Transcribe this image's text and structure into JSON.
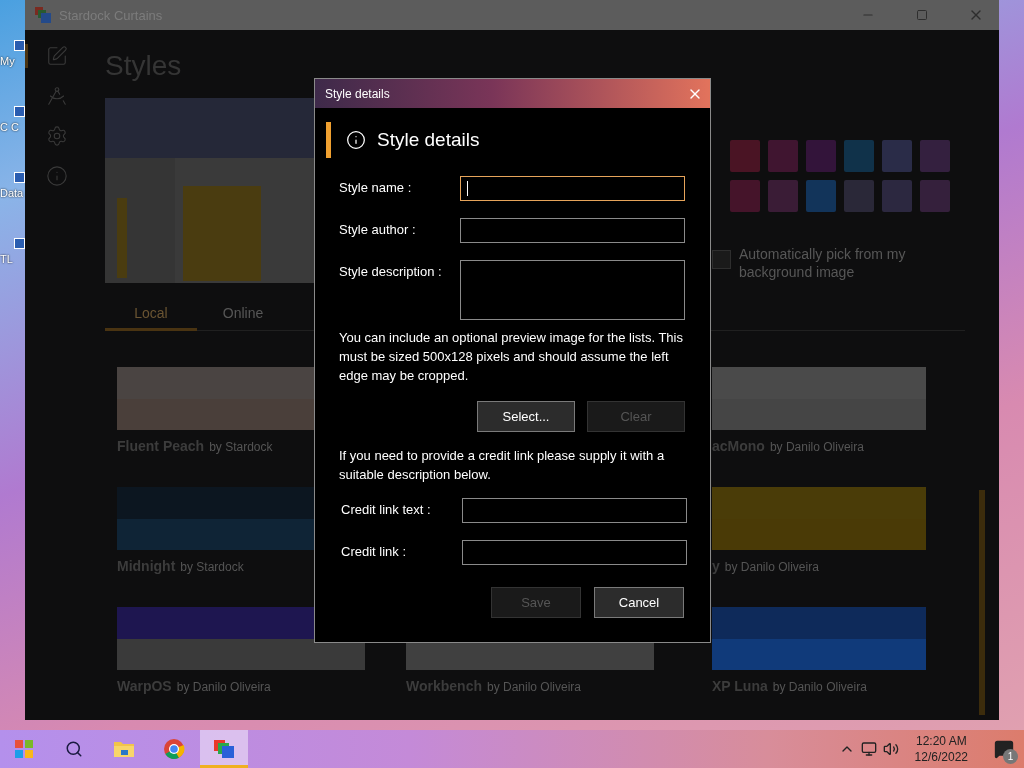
{
  "desktop_icons": [
    {
      "label": "My"
    },
    {
      "label": "C C"
    },
    {
      "label": "Data"
    },
    {
      "label": "TL"
    }
  ],
  "app": {
    "title": "Stardock Curtains",
    "sidebar": [
      {
        "kind": "edit",
        "selected": true
      },
      {
        "kind": "drafting",
        "selected": false
      },
      {
        "kind": "settings",
        "selected": false
      },
      {
        "kind": "info",
        "selected": false
      }
    ],
    "heading": "Styles",
    "swatches": [
      {
        "color": "#4a1424"
      },
      {
        "color": "#401530"
      },
      {
        "color": "#33143a"
      },
      {
        "color": "#10324a"
      },
      {
        "color": "#2a2c48"
      },
      {
        "color": "#34203f"
      },
      {
        "color": "#45142a"
      },
      {
        "color": "#3a1c36"
      },
      {
        "color": "#12345a"
      },
      {
        "color": "#2a2838"
      },
      {
        "color": "#2c2840"
      },
      {
        "color": "#35203c"
      }
    ],
    "auto_pick": {
      "label": "Automatically pick from my background image",
      "checked": false
    },
    "tabs": [
      {
        "label": "Local",
        "selected": true
      },
      {
        "label": "Online",
        "selected": false
      }
    ],
    "style_columns": [
      [
        {
          "kind": "peach",
          "name": "Fluent Peach",
          "author": "by Stardock"
        },
        {
          "kind": "midnight",
          "name": "Midnight",
          "author": "by Stardock"
        },
        {
          "kind": "warp",
          "name": "WarpOS",
          "author": "by Danilo Oliveira"
        }
      ],
      [
        {
          "kind": "workbench",
          "name": "Workbench",
          "author": "by Danilo Oliveira"
        }
      ],
      [
        {
          "kind": "mac",
          "name": "acMono",
          "author": "by Danilo Oliveira"
        },
        {
          "kind": "yellow",
          "name": "y",
          "author": "by Danilo Oliveira"
        },
        {
          "kind": "luna",
          "name": "XP Luna",
          "author": "by Danilo Oliveira"
        }
      ]
    ]
  },
  "dialog": {
    "title": "Style details",
    "heading": "Style details",
    "fields": [
      {
        "label": "Style name :",
        "focused": true,
        "kind": "line"
      },
      {
        "label": "Style author :",
        "focused": false,
        "kind": "line"
      },
      {
        "label": "Style description :",
        "focused": false,
        "kind": "area"
      }
    ],
    "preview_note": "You can include an optional preview image for the lists. This must be sized 500x128 pixels and should assume the left edge may be cropped.",
    "preview_buttons": [
      {
        "label": "Select...",
        "disabled": false
      },
      {
        "label": "Clear",
        "disabled": true
      }
    ],
    "credit_note": "If you need to provide a credit link please supply it with a suitable description below.",
    "credit_fields": [
      {
        "label": "Credit link text :",
        "focused": false,
        "kind": "line"
      },
      {
        "label": "Credit link :",
        "focused": false,
        "kind": "line"
      }
    ],
    "buttons": [
      {
        "label": "Save",
        "disabled": true
      },
      {
        "label": "Cancel",
        "disabled": false
      }
    ]
  },
  "taskbar": {
    "apps": [
      {
        "kind": "start",
        "selected": false
      },
      {
        "kind": "search",
        "selected": false
      },
      {
        "kind": "folder",
        "selected": false
      },
      {
        "kind": "browser",
        "selected": false
      },
      {
        "kind": "curtains",
        "selected": true
      }
    ],
    "time": "12:20 AM",
    "date": "12/6/2022",
    "notifications": "1"
  }
}
